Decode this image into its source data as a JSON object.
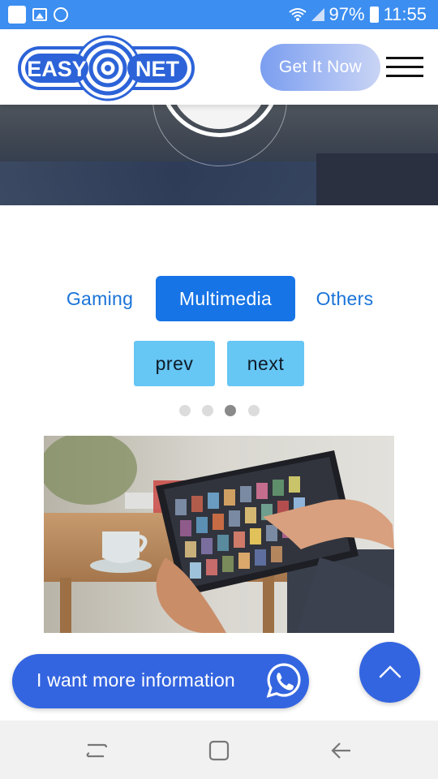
{
  "status_bar": {
    "battery_percent": "97%",
    "time": "11:55",
    "icons": [
      "app-square-icon",
      "gallery-icon",
      "whatsapp-icon",
      "wifi-icon",
      "signal-icon",
      "battery-icon"
    ]
  },
  "header": {
    "logo_text_left": "EASY",
    "logo_text_right": "NET",
    "cta_label": "Get It Now",
    "menu_icon": "hamburger-icon"
  },
  "tabs": [
    {
      "label": "Gaming",
      "active": false
    },
    {
      "label": "Multimedia",
      "active": true
    },
    {
      "label": "Others",
      "active": false
    }
  ],
  "pager": {
    "prev_label": "prev",
    "next_label": "next"
  },
  "carousel": {
    "slide_count": 4,
    "active_index": 2
  },
  "contact": {
    "banner_label": "I want more information",
    "banner_icon": "whatsapp-icon",
    "scroll_top_icon": "chevron-up-icon"
  },
  "colors": {
    "status_bar": "#3c8ef0",
    "brand_blue": "#3465e0",
    "tab_active": "#1774e6",
    "tab_text": "#1a73d8",
    "pager_bg": "#66c6f4"
  }
}
